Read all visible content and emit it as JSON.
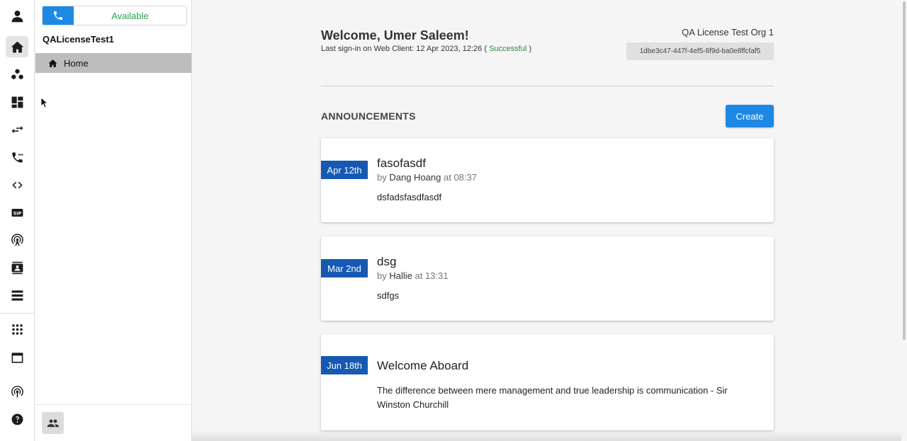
{
  "rail": {
    "icons": [
      "user-icon",
      "home-icon",
      "users-icon",
      "dashboard-icon",
      "transfer-icon",
      "call-flow-icon",
      "code-icon",
      "sip-icon",
      "antenna-icon",
      "contacts-icon",
      "list-icon",
      "apps-icon",
      "window-icon",
      "broadcast-icon",
      "help-icon"
    ],
    "sip_label": "SIP"
  },
  "sidebar": {
    "presence_status": "Available",
    "org_name": "QALicenseTest1",
    "home_label": "Home"
  },
  "header": {
    "welcome": "Welcome, Umer Saleem!",
    "last_signin_prefix": "Last sign-in on Web Client: 12 Apr 2023, 12:26 (",
    "last_signin_status": "Successful",
    "last_signin_suffix": ")",
    "org_title": "QA License Test Org 1",
    "org_id": "1dbe3c47-447f-4ef5-8f9d-ba0e8ffcfaf5"
  },
  "announcements": {
    "title": "ANNOUNCEMENTS",
    "create_label": "Create",
    "items": [
      {
        "date": "Apr 12th",
        "title": "fasofasdf",
        "by": "by",
        "author": "Dang Hoang",
        "at": "at 08:37",
        "body": "dsfadsfasdfasdf"
      },
      {
        "date": "Mar 2nd",
        "title": "dsg",
        "by": "by",
        "author": "Hallie",
        "at": "at 13:31",
        "body": "sdfgs"
      },
      {
        "date": "Jun 18th",
        "title": "Welcome Aboard",
        "body": "The difference between mere management and true leadership is communication - Sir Winston Churchill"
      }
    ]
  },
  "colors": {
    "accent": "#1e88e5",
    "date_badge": "#1559b3",
    "available": "#2e9e4f"
  }
}
